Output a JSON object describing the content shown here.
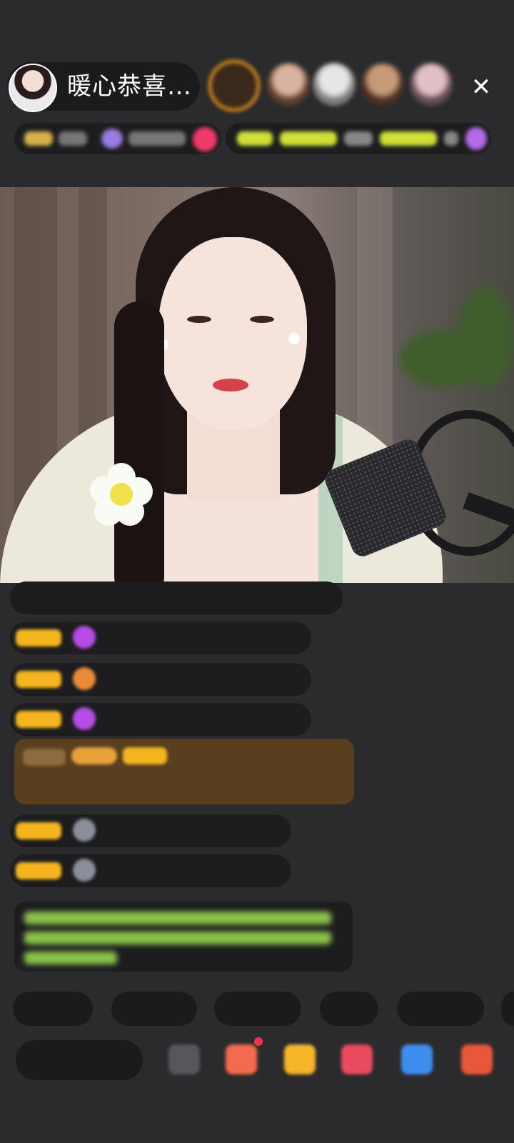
{
  "header": {
    "host_name": "暖心恭喜…",
    "close_icon": "✕",
    "viewers": [
      "viewer-1",
      "viewer-2",
      "viewer-3",
      "viewer-4",
      "viewer-5"
    ]
  },
  "chat": {
    "messages": [
      "",
      "",
      "",
      "",
      "",
      ""
    ]
  },
  "quick_replies": [
    "",
    "",
    "",
    "",
    ""
  ],
  "input": {
    "placeholder": ""
  },
  "colors": {
    "background": "#2b2b2d",
    "pill": "#1b1b1d",
    "accent_orange": "#f09a1a",
    "highlight_banner": "#5a3f1e",
    "notification_red": "#f2314b"
  }
}
